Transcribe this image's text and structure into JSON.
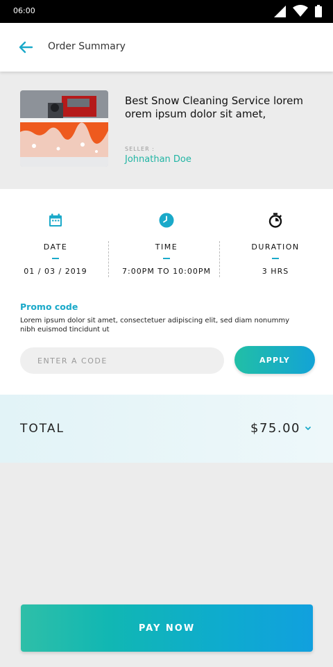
{
  "status_bar": {
    "time": "06:00"
  },
  "header": {
    "title": "Order Summary"
  },
  "product": {
    "title": "Best Snow Cleaning Service lorem orem ipsum dolor sit amet,",
    "seller_label": "SELLER :",
    "seller_name": "Johnathan Doe"
  },
  "info": {
    "date": {
      "label": "DATE",
      "value": "01 / 03 / 2019"
    },
    "time": {
      "label": "TIME",
      "value": "7:00PM TO 10:00PM"
    },
    "duration": {
      "label": "DURATION",
      "value": "3 HRS"
    }
  },
  "promo": {
    "title": "Promo code",
    "description": "Lorem ipsum dolor sit amet, consectetuer adipiscing elit, sed diam nonummy nibh euismod tincidunt ut",
    "placeholder": "ENTER A CODE",
    "apply_label": "APPLY"
  },
  "total": {
    "label": "TOTAL",
    "amount": "$75.00"
  },
  "pay_button": {
    "label": "PAY NOW"
  },
  "colors": {
    "accent": "#1aa9c9",
    "seller": "#21b5a4",
    "gradient_start": "#21bfa6",
    "gradient_end": "#13a3d6"
  },
  "icons": {
    "back": "arrow-left-icon",
    "date": "calendar-icon",
    "time": "clock-icon",
    "duration": "stopwatch-icon",
    "total_expand": "chevron-down-icon"
  }
}
